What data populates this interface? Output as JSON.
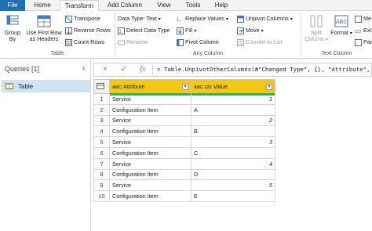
{
  "tabs": [
    "File",
    "Home",
    "Transform",
    "Add Column",
    "View",
    "Tools",
    "Help"
  ],
  "ribbon": {
    "table_group": {
      "label": "Table",
      "group_by": "Group\nBy",
      "use_first_row": "Use First Row\nas Headers",
      "transpose": "Transpose",
      "reverse_rows": "Reverse Rows",
      "count_rows": "Count Rows"
    },
    "any_column_group": {
      "label": "Any Column",
      "data_type": "Data Type: Text",
      "detect_data_type": "Detect Data Type",
      "rename": "Rename",
      "replace_values": "Replace Values",
      "fill": "Fill",
      "pivot_column": "Pivot Column",
      "unpivot_columns": "Unpivot Columns",
      "move": "Move",
      "convert_to_list": "Convert to List"
    },
    "text_column_group": {
      "label": "Text Column",
      "split_column": "Split\nColumn",
      "format": "Format",
      "merge": "Me",
      "extract": "Ext",
      "parse": "Par"
    }
  },
  "formula_bar": {
    "cancel_glyph": "×",
    "accept_glyph": "✓",
    "fx_glyph": "fx",
    "formula": "= Table.UnpivotOtherColumns(#\"Changed Type\", {}, \"Attribute\", \""
  },
  "queries": {
    "title": "Queries [1]",
    "items": [
      {
        "label": "Table"
      }
    ]
  },
  "grid": {
    "columns": [
      {
        "name": "Attribute",
        "type": "ABC"
      },
      {
        "name": "Value",
        "type": "ABC 123"
      }
    ],
    "rows": [
      {
        "n": "1",
        "attribute": "Service",
        "value": "1"
      },
      {
        "n": "2",
        "attribute": "Configuration Item",
        "value": "A"
      },
      {
        "n": "3",
        "attribute": "Service",
        "value": "2"
      },
      {
        "n": "4",
        "attribute": "Configuration Item",
        "value": "B"
      },
      {
        "n": "5",
        "attribute": "Service",
        "value": "3"
      },
      {
        "n": "6",
        "attribute": "Configuration Item",
        "value": "C"
      },
      {
        "n": "7",
        "attribute": "Service",
        "value": "4"
      },
      {
        "n": "8",
        "attribute": "Configuration Item",
        "value": "D"
      },
      {
        "n": "9",
        "attribute": "Service",
        "value": "5"
      },
      {
        "n": "10",
        "attribute": "Configuration Item",
        "value": "E"
      }
    ]
  }
}
